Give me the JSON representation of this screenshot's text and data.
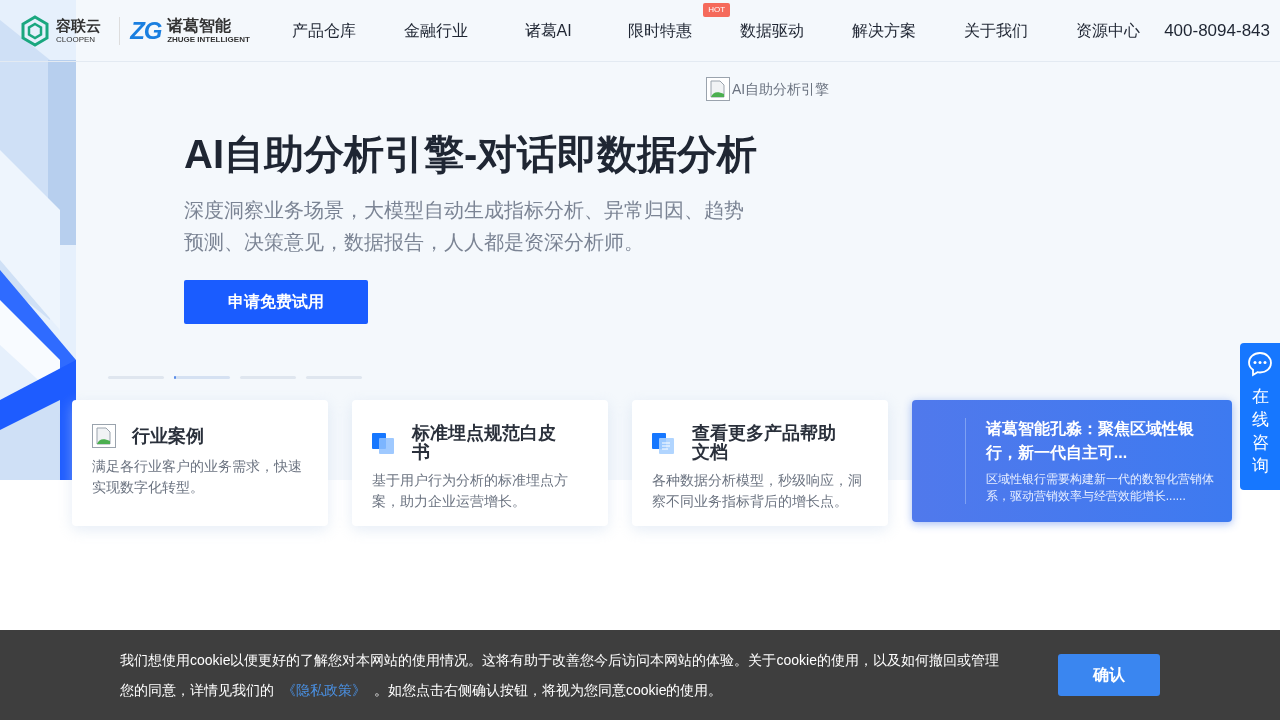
{
  "header": {
    "logo_primary": {
      "name": "容联云",
      "sub": "CLOOPEN"
    },
    "logo_secondary": {
      "mark": "ZG",
      "name": "诸葛智能",
      "sub": "ZHUGE INTELLIGENT"
    },
    "nav": [
      {
        "label": "产品仓库"
      },
      {
        "label": "金融行业"
      },
      {
        "label": "诸葛AI"
      },
      {
        "label": "限时特惠",
        "badge": "HOT"
      },
      {
        "label": "数据驱动"
      },
      {
        "label": "解决方案"
      },
      {
        "label": "关于我们"
      },
      {
        "label": "资源中心"
      }
    ],
    "phone": "400-8094-843"
  },
  "hero": {
    "image_alt": "AI自助分析引擎",
    "title": "AI自助分析引擎-对话即数据分析",
    "description": "深度洞察业务场景，大模型自动生成指标分析、异常归因、趋势预测、决策意见，数据报告，人人都是资深分析师。",
    "cta": "申请免费试用",
    "indicators": [
      {
        "selected": false
      },
      {
        "selected": true,
        "level": 0.04
      },
      {
        "selected": false
      },
      {
        "selected": false
      }
    ]
  },
  "cards": [
    {
      "kind": "feature",
      "title": "行业案例",
      "description": "满足各行业客户的业务需求，快速实现数字化转型。"
    },
    {
      "kind": "feature",
      "title": "标准埋点规范白皮书",
      "description": "基于用户行为分析的标准埋点方案，助力企业运营增长。"
    },
    {
      "kind": "feature",
      "title": "查看更多产品帮助文档",
      "description": "各种数据分析模型，秒级响应，洞察不同业务指标背后的增长点。"
    },
    {
      "kind": "news",
      "title": "诸葛智能孔淼：聚焦区域性银行，新一代自主可...",
      "description": "区域性银行需要构建新一代的数智化营销体系，驱动营销效率与经营效能增长......"
    }
  ],
  "consult": {
    "label": "在线咨询"
  },
  "cookie_banner": {
    "text": "我们想使用cookie以便更好的了解您对本网站的使用情况。这将有助于改善您今后访问本网站的体验。关于cookie的使用，以及如何撤回或管理您的同意，详情见我们的",
    "link": "《隐私政策》",
    "text_after": "。如您点击右侧确认按钮，将视为您同意cookie的使用。",
    "button": "确认"
  }
}
